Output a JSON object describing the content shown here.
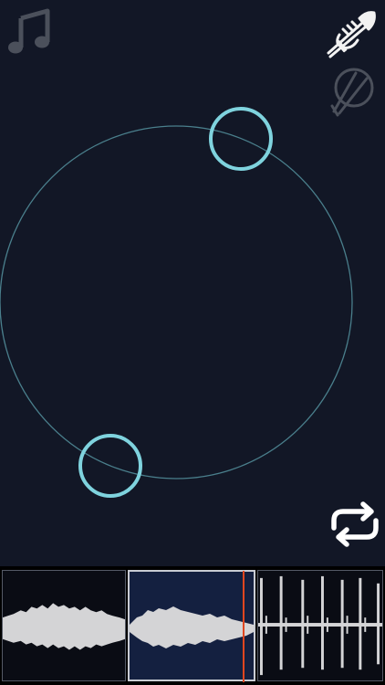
{
  "icons": {
    "music": "music-note-icon",
    "trumpet": "trumpet-icon",
    "instrument2": "tambourine-icon",
    "loop": "loop-icon"
  },
  "colors": {
    "background": "#121726",
    "circle_stroke": "#4a7f8c",
    "handle_stroke": "#7fd3de",
    "waveform": "#d4d4d6",
    "playhead": "#e0461f",
    "selected_clip_bg": "#142040"
  },
  "waveform": {
    "clip_count": 3,
    "selected_clip": 2,
    "playhead_position_in_selected": 0.9
  }
}
